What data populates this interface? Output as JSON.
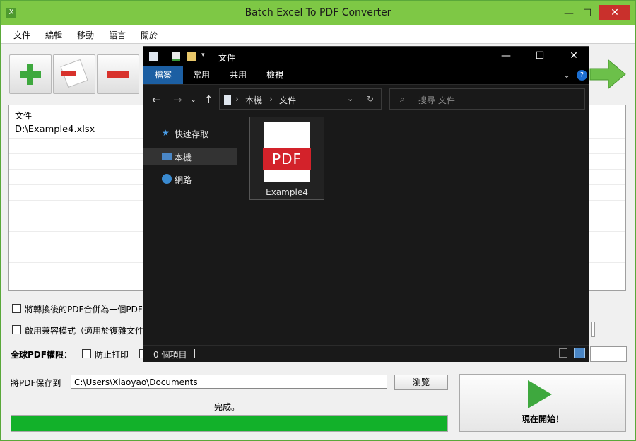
{
  "app": {
    "title": "Batch Excel To PDF Converter",
    "icon": "excel-icon",
    "controls": {
      "minimize": "—",
      "maximize": "☐",
      "close": "✕"
    }
  },
  "menu": [
    "文件",
    "編輯",
    "移動",
    "語言",
    "關於"
  ],
  "toolbar": [
    "add-file",
    "remove-file",
    "remove-all"
  ],
  "file_list": {
    "header": "文件",
    "rows": [
      "D:\\Example4.xlsx"
    ]
  },
  "options": {
    "merge_label": "將轉換後的PDF合併為一個PDF",
    "compat_label": "啟用兼容模式（適用於復雜文件）",
    "permissions_label": "全球PDF權限：",
    "no_print_label": "防止打印"
  },
  "save": {
    "label": "將PDF保存到",
    "path": "C:\\Users\\Xiaoyao\\Documents",
    "browse_label": "瀏覽"
  },
  "status": {
    "text": "完成。",
    "progress": 1.0
  },
  "start_button": {
    "label": "現在開始！"
  },
  "explorer": {
    "title": "文件",
    "controls": {
      "minimize": "—",
      "maximize": "☐",
      "close": "✕"
    },
    "ribbon_tabs": [
      "檔案",
      "常用",
      "共用",
      "檢視"
    ],
    "address": [
      "本機",
      "文件"
    ],
    "search_placeholder": "搜尋 文件",
    "sidebar": [
      {
        "label": "快速存取",
        "icon": "star-icon"
      },
      {
        "label": "本機",
        "icon": "computer-icon"
      },
      {
        "label": "網路",
        "icon": "network-icon"
      }
    ],
    "files": [
      {
        "name": "Example4",
        "type_label": "PDF"
      }
    ],
    "status": "0 個項目"
  },
  "colors": {
    "title_bar": "#7ec845",
    "progress": "#12b12a",
    "pdf_red": "#d3222a",
    "ribbon_active": "#1c5fa3"
  }
}
